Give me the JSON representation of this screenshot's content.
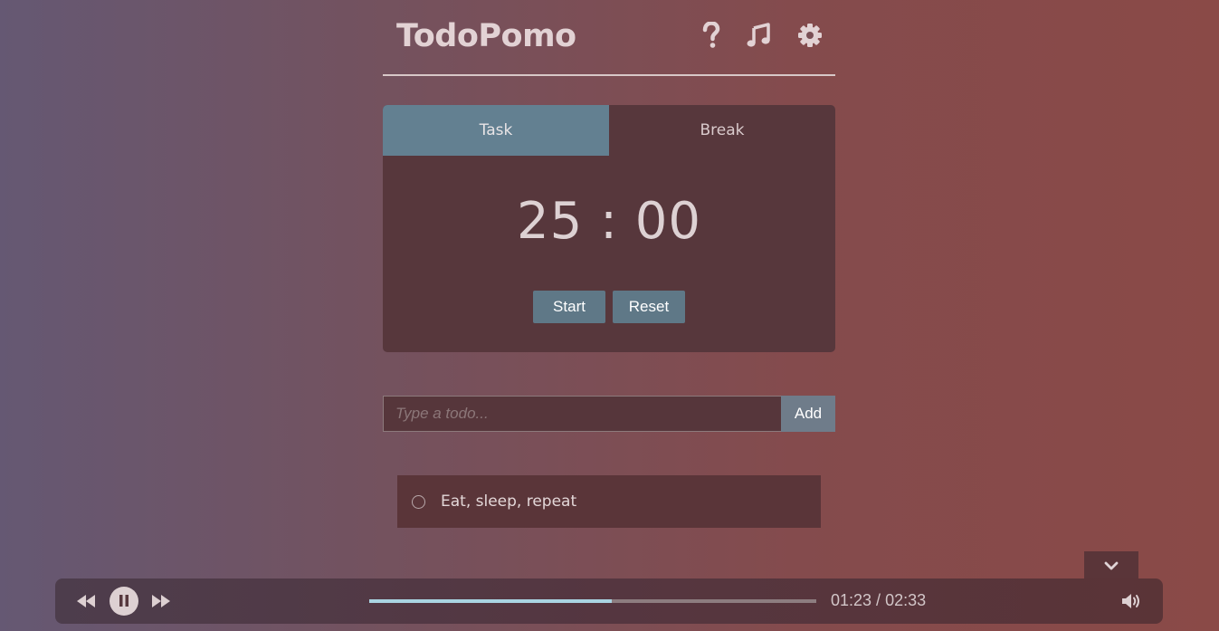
{
  "header": {
    "title": "TodoPomo",
    "icons": [
      "help-icon",
      "music-icon",
      "settings-icon"
    ]
  },
  "timer": {
    "tabs": [
      {
        "label": "Task",
        "active": true
      },
      {
        "label": "Break",
        "active": false
      }
    ],
    "minutes": "25",
    "separator": ":",
    "seconds": "00",
    "start_label": "Start",
    "reset_label": "Reset"
  },
  "todo_form": {
    "placeholder": "Type a todo...",
    "value": "",
    "add_label": "Add"
  },
  "todos": [
    {
      "text": "Eat, sleep, repeat",
      "done": false
    }
  ],
  "player": {
    "current_time": "01:23",
    "total_time": "02:33",
    "time_separator": " / ",
    "progress_fraction": 0.542,
    "state": "playing",
    "icons": [
      "rewind-icon",
      "pause-icon",
      "fast-forward-icon",
      "volume-icon",
      "chevron-down-icon"
    ]
  },
  "colors": {
    "tab_active": "#638091",
    "card": "#57373c",
    "button": "#5f7887",
    "progress": "#aad4e2"
  }
}
